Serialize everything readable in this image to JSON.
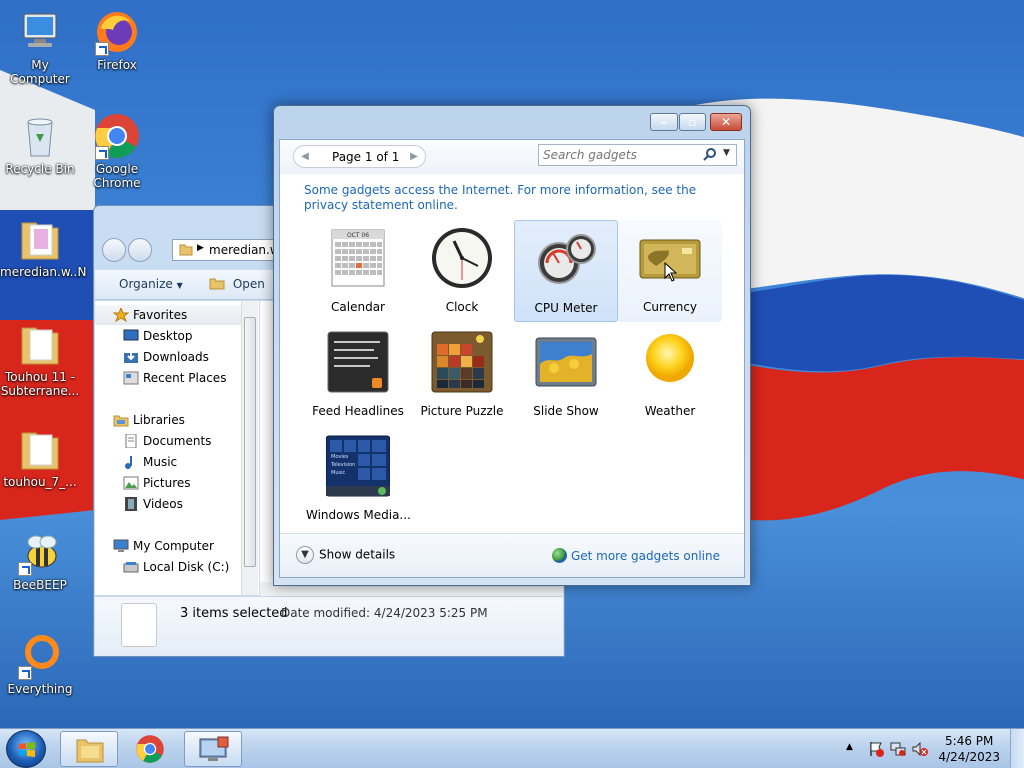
{
  "desktop": {
    "icons": [
      {
        "label": "My Computer"
      },
      {
        "label": "Firefox"
      },
      {
        "label": "Recycle Bin"
      },
      {
        "label": "Google Chrome"
      },
      {
        "label": "meredian.w..."
      },
      {
        "label": "Touhou 11 - Subterrane..."
      },
      {
        "label": "touhou_7_..."
      },
      {
        "label": "BeeBEEP"
      },
      {
        "label": "Everything"
      }
    ],
    "partial_icon_label": "N"
  },
  "explorer": {
    "address": "meredian.w",
    "toolbar": {
      "organize": "Organize",
      "open": "Open"
    },
    "nav": {
      "favorites": "Favorites",
      "desktop": "Desktop",
      "downloads": "Downloads",
      "recent_places": "Recent Places",
      "libraries": "Libraries",
      "documents": "Documents",
      "music": "Music",
      "pictures": "Pictures",
      "videos": "Videos",
      "my_computer": "My Computer",
      "local_disk": "Local Disk (C:)"
    },
    "details": {
      "selected": "3 items selected",
      "modified": "Date modified: 4/24/2023 5:25 PM"
    }
  },
  "gadgets": {
    "page_label": "Page 1 of 1",
    "search_placeholder": "Search gadgets",
    "notice": "Some gadgets access the Internet.  For more information, see the privacy statement online.",
    "items": [
      {
        "label": "Calendar"
      },
      {
        "label": "Clock"
      },
      {
        "label": "CPU Meter"
      },
      {
        "label": "Currency"
      },
      {
        "label": "Feed Headlines"
      },
      {
        "label": "Picture Puzzle"
      },
      {
        "label": "Slide Show"
      },
      {
        "label": "Weather"
      },
      {
        "label": "Windows Media..."
      }
    ],
    "calendar_month": "OCT 06",
    "media_menu": [
      "Movies",
      "Television",
      "Music"
    ],
    "show_details": "Show details",
    "get_more": "Get more gadgets online"
  },
  "taskbar": {
    "time": "5:46 PM",
    "date": "4/24/2023"
  },
  "colors": {
    "link": "#1c67b8",
    "selection": "#cfe2f8",
    "taskbar": "#b9d1ec"
  }
}
